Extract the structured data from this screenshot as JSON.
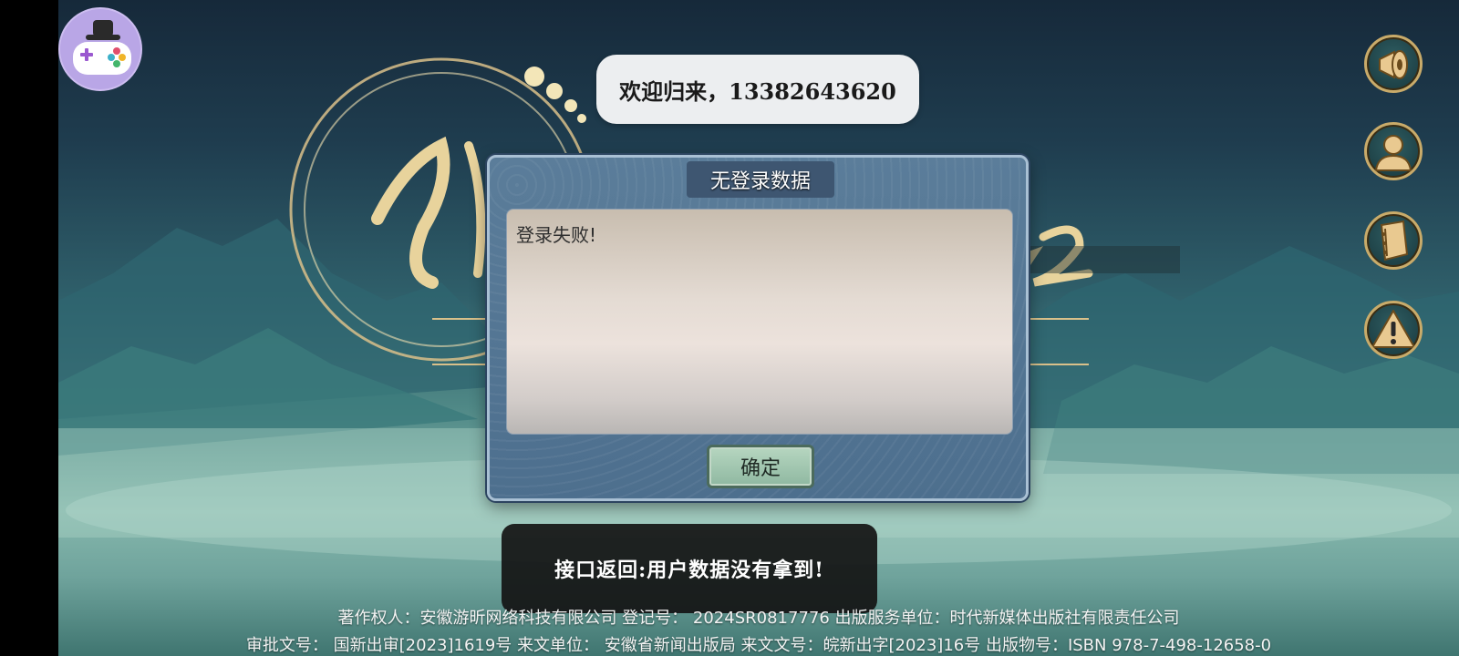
{
  "welcome": {
    "text": "欢迎归来，13382643620"
  },
  "dialog": {
    "title": "无登录数据",
    "message": "登录失败!",
    "ok_label": "确定"
  },
  "toast": {
    "text": "接口返回:用户数据没有拿到!"
  },
  "footer": {
    "line1": "著作权人：安徽游昕网络科技有限公司  登记号：  2024SR0817776  出版服务单位：时代新媒体出版社有限责任公司",
    "line2": "审批文号：  国新出审[2023]1619号  来文单位：  安徽省新闻出版局  来文文号：皖新出字[2023]16号  出版物号：ISBN 978-7-498-12658-0"
  },
  "side_buttons": [
    {
      "icon": "announcement-icon"
    },
    {
      "icon": "account-icon"
    },
    {
      "icon": "notice-book-icon"
    },
    {
      "icon": "warning-icon"
    }
  ],
  "colors": {
    "dialog_bg": "#4d6f8e",
    "dialog_title_bg": "#3e5671",
    "ok_button": "#8fb8a1",
    "button_border": "#c9ab6a",
    "avatar_bg": "#b9a6e6"
  }
}
